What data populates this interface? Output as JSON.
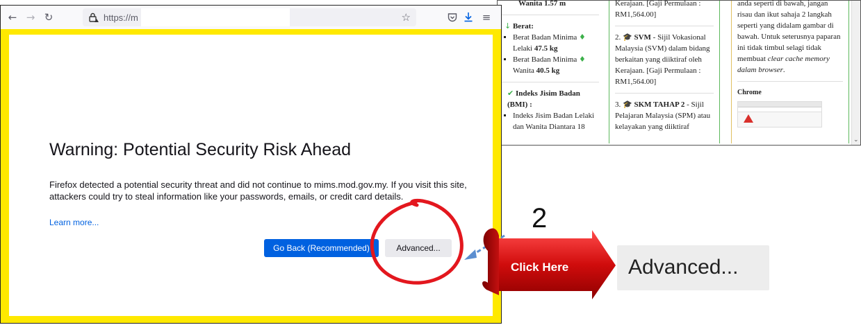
{
  "browser": {
    "url_text": "https://m",
    "warning_title": "Warning: Potential Security Risk Ahead",
    "warning_text": "Firefox detected a potential security threat and did not continue to mims.mod.gov.my. If you visit this site, attackers could try to steal information like your passwords, emails, or credit card details.",
    "learn_more": "Learn more...",
    "go_back_label": "Go Back (Recommended)",
    "advanced_label": "Advanced..."
  },
  "annotation": {
    "step_number": "2",
    "click_here": "Click Here",
    "advanced_zoom": "Advanced...",
    "circle_color": "#e3171e",
    "arrow_color": "#5b8ed0",
    "highlight_color": "#ffe900"
  },
  "background_page": {
    "col1": {
      "height_line": "Wanita 1.57 m",
      "berat_heading": "Berat:",
      "berat_items": [
        {
          "text": "Berat Badan Minima",
          "tail": "Lelaki ",
          "value": "47.5 kg"
        },
        {
          "text": "Berat Badan Minima",
          "tail": "Wanita ",
          "value": "40.5 kg"
        }
      ],
      "bmi_heading": "Indeks Jisim Badan (BMI) :",
      "bmi_item": "Indeks Jisim Badan Lelaki dan Wanita Diantara 18"
    },
    "col2": {
      "top_text": "Kerajaan. [Gaji Permulaan : RM1,564.00]",
      "item2_num": "2.",
      "item2_title": "SVM",
      "item2_text": " - Sijil Vokasional Malaysia (SVM) dalam bidang berkaitan yang diiktiraf oleh Kerajaan. [Gaji Permulaan : RM1,564.00]",
      "item3_num": "3.",
      "item3_title": "SKM TAHAP 2",
      "item3_text": " - Sijil Pelajaran Malaysia (SPM) atau kelayakan yang diiktiraf"
    },
    "col3": {
      "text_plain": "anda seperti di bawah, jangan risau dan ikut sahaja 2 langkah seperti yang didalam gambar di bawah. Untuk seterusnya paparan ini tidak timbul selagi tidak membuat ",
      "text_italic": "clear cache memory dalam browser",
      "text_end": ".",
      "chrome_label": "Chrome"
    }
  },
  "icons": {
    "back": "back-arrow-icon",
    "forward": "forward-arrow-icon",
    "reload": "reload-icon",
    "lock": "lock-warning-icon",
    "star": "star-icon",
    "pocket": "pocket-icon",
    "download": "download-icon",
    "menu": "hamburger-menu-icon"
  }
}
